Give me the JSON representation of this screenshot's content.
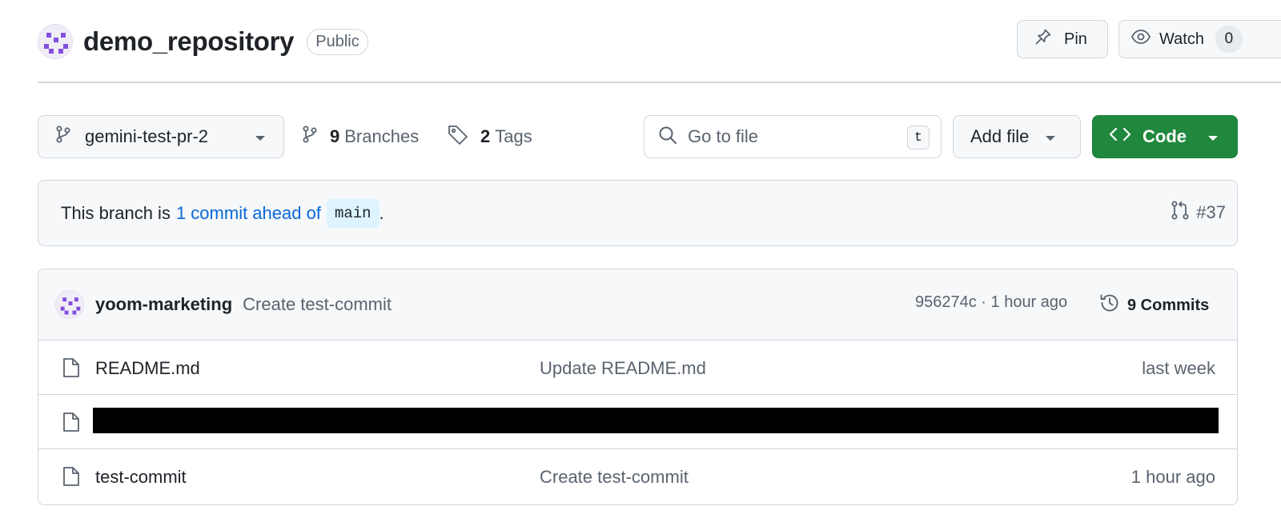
{
  "repo": {
    "name": "demo_repository",
    "visibility": "Public"
  },
  "header_actions": {
    "pin_label": "Pin",
    "watch_label": "Watch",
    "watch_count": "0"
  },
  "toolbar": {
    "branch": "gemini-test-pr-2",
    "branches_count": "9",
    "branches_label": "Branches",
    "tags_count": "2",
    "tags_label": "Tags",
    "search_placeholder": "Go to file",
    "search_shortcut": "t",
    "add_file_label": "Add file",
    "code_label": "Code"
  },
  "ahead_banner": {
    "prefix": "This branch is",
    "link_text": "1 commit ahead of",
    "base_branch": "main",
    "suffix": ".",
    "pr_number": "#37"
  },
  "latest_commit": {
    "author": "yoom-marketing",
    "message": "Create test-commit",
    "sha_time": "956274c · 1 hour ago",
    "commits_label": "9 Commits"
  },
  "files": [
    {
      "name": "README.md",
      "message": "Update README.md",
      "date": "last week",
      "redacted": false
    },
    {
      "name": "",
      "message": "",
      "date": "",
      "redacted": true
    },
    {
      "name": "test-commit",
      "message": "Create test-commit",
      "date": "1 hour ago",
      "redacted": false
    }
  ],
  "colors": {
    "accent_green": "#1f883d",
    "link_blue": "#0969da",
    "avatar_purple": "#8250df",
    "border": "#d0d7de"
  },
  "icons": [
    "repo-avatar",
    "pin-icon",
    "eye-icon",
    "git-branch-icon",
    "tag-icon",
    "search-icon",
    "code-icon",
    "chevron-down-icon",
    "pull-request-icon",
    "history-icon",
    "file-icon"
  ]
}
